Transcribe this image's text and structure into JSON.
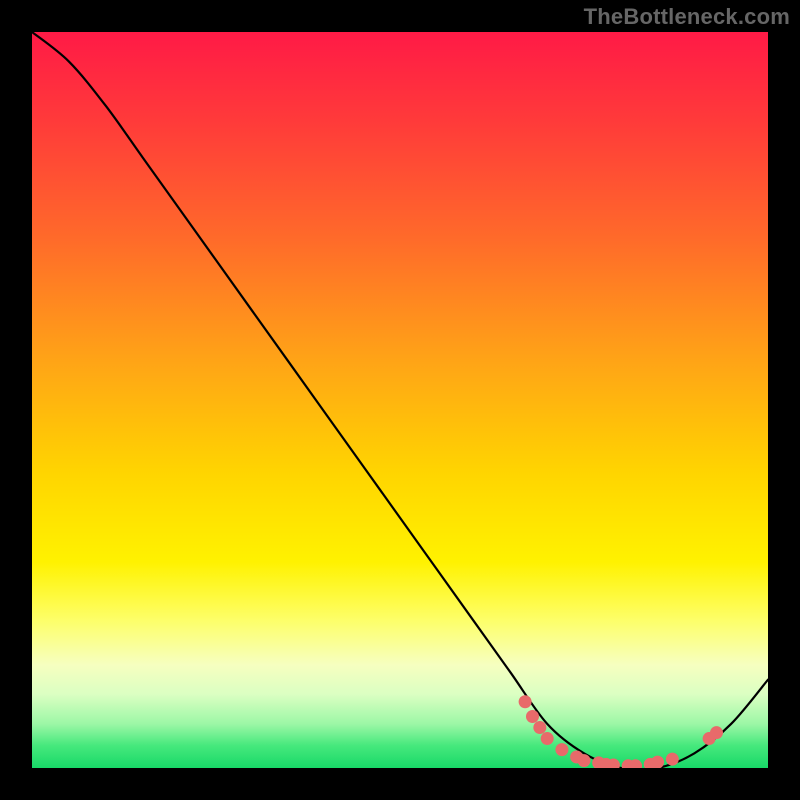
{
  "watermark": "TheBottleneck.com",
  "chart_data": {
    "type": "line",
    "title": "",
    "xlabel": "",
    "ylabel": "",
    "xlim": [
      0,
      100
    ],
    "ylim": [
      0,
      100
    ],
    "grid": false,
    "legend": false,
    "series": [
      {
        "name": "curve",
        "x": [
          0,
          5,
          10,
          15,
          20,
          25,
          30,
          35,
          40,
          45,
          50,
          55,
          60,
          65,
          70,
          75,
          80,
          85,
          90,
          95,
          100
        ],
        "y": [
          100,
          96,
          90,
          83,
          76,
          69,
          62,
          55,
          48,
          41,
          34,
          27,
          20,
          13,
          6,
          2,
          0,
          0,
          2,
          6,
          12
        ]
      }
    ],
    "points": [
      {
        "name": "p1",
        "x": 67,
        "y": 9
      },
      {
        "name": "p2",
        "x": 68,
        "y": 7
      },
      {
        "name": "p3",
        "x": 69,
        "y": 5.5
      },
      {
        "name": "p4",
        "x": 70,
        "y": 4
      },
      {
        "name": "p5",
        "x": 72,
        "y": 2.5
      },
      {
        "name": "p6",
        "x": 74,
        "y": 1.5
      },
      {
        "name": "p7",
        "x": 75,
        "y": 1
      },
      {
        "name": "p8",
        "x": 77,
        "y": 0.7
      },
      {
        "name": "p9",
        "x": 78,
        "y": 0.5
      },
      {
        "name": "p10",
        "x": 79,
        "y": 0.4
      },
      {
        "name": "p11",
        "x": 81,
        "y": 0.3
      },
      {
        "name": "p12",
        "x": 82,
        "y": 0.3
      },
      {
        "name": "p13",
        "x": 84,
        "y": 0.5
      },
      {
        "name": "p14",
        "x": 85,
        "y": 0.8
      },
      {
        "name": "p15",
        "x": 87,
        "y": 1.2
      },
      {
        "name": "p16",
        "x": 92,
        "y": 4
      },
      {
        "name": "p17",
        "x": 93,
        "y": 4.8
      }
    ],
    "gradient_colors": {
      "top": "#ff1a46",
      "mid1": "#ffa516",
      "mid2": "#fff200",
      "bottom": "#18d968"
    }
  }
}
